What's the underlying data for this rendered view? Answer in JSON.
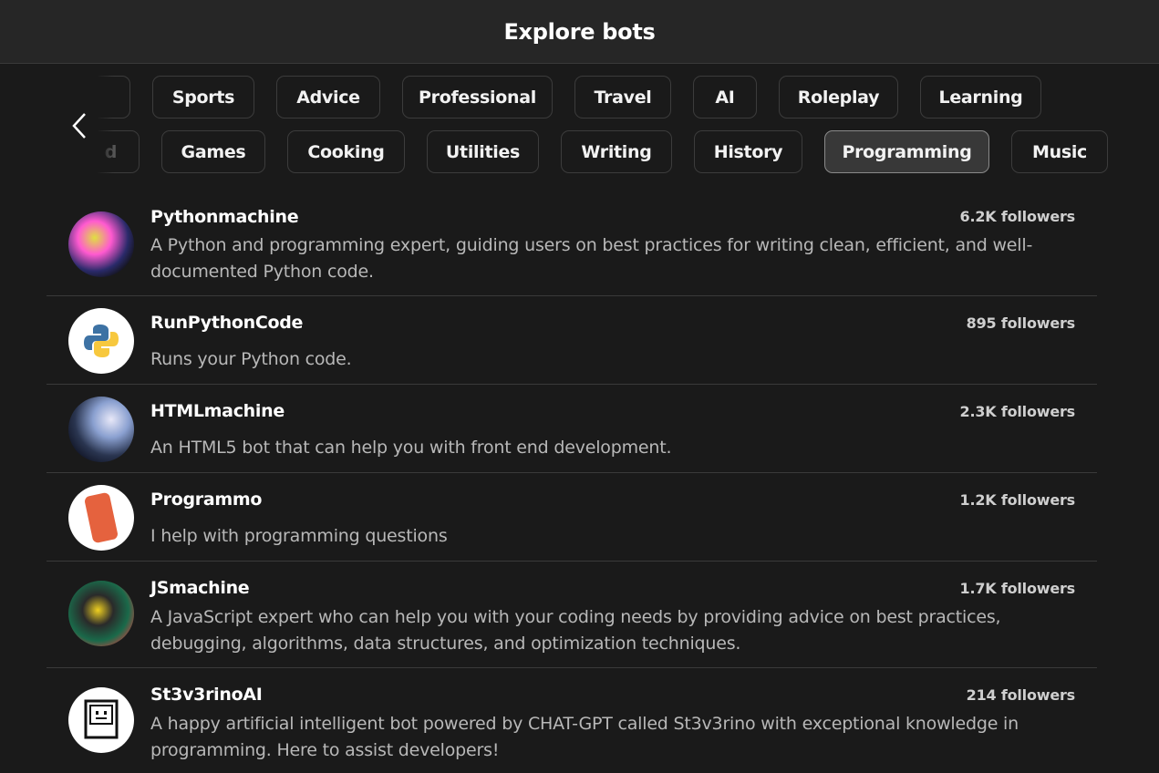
{
  "header": {
    "title": "Explore bots"
  },
  "categories": {
    "row1": [
      {
        "label": ""
      },
      {
        "label": "Sports"
      },
      {
        "label": "Advice"
      },
      {
        "label": "Professional"
      },
      {
        "label": "Travel"
      },
      {
        "label": "AI"
      },
      {
        "label": "Roleplay"
      },
      {
        "label": "Learning"
      }
    ],
    "row2": [
      {
        "label": "d"
      },
      {
        "label": "Games"
      },
      {
        "label": "Cooking"
      },
      {
        "label": "Utilities"
      },
      {
        "label": "Writing"
      },
      {
        "label": "History"
      },
      {
        "label": "Programming",
        "selected": true
      },
      {
        "label": "Music"
      }
    ]
  },
  "bots": [
    {
      "name": "Pythonmachine",
      "followers": "6.2K followers",
      "description": "A Python and programming expert, guiding users on best practices for writing clean, efficient, and well-documented Python code."
    },
    {
      "name": "RunPythonCode",
      "followers": "895 followers",
      "description": "Runs your Python code."
    },
    {
      "name": "HTMLmachine",
      "followers": "2.3K followers",
      "description": "An HTML5 bot that can help you with front end development."
    },
    {
      "name": "Programmo",
      "followers": "1.2K followers",
      "description": "I help with programming questions"
    },
    {
      "name": "JSmachine",
      "followers": "1.7K followers",
      "description": "A JavaScript expert who can help you with your coding needs by providing advice on best practices, debugging, algorithms, data structures, and optimization techniques."
    },
    {
      "name": "St3v3rinoAI",
      "followers": "214 followers",
      "description": "A happy artificial intelligent bot powered by CHAT-GPT called St3v3rino with exceptional knowledge in programming. Here to assist developers!"
    }
  ]
}
